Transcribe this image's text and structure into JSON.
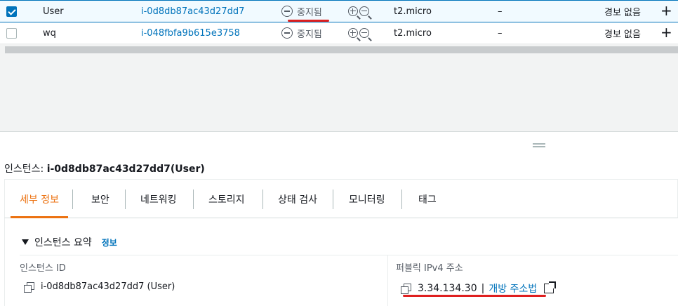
{
  "instances": [
    {
      "name": "User",
      "id": "i-0d8db87ac43d27dd7",
      "state": "중지됨",
      "type": "t2.micro",
      "status_check": "–",
      "alarm": "경보 없음",
      "checked": true
    },
    {
      "name": "wq",
      "id": "i-048fbfa9b615e3758",
      "state": "중지됨",
      "type": "t2.micro",
      "status_check": "–",
      "alarm": "경보 없음",
      "checked": false
    }
  ],
  "row_add_label": "+",
  "detail": {
    "title_prefix": "인스턴스: ",
    "title_value": "i-0d8db87ac43d27dd7(User)"
  },
  "tabs": [
    "세부 정보",
    "보안",
    "네트워킹",
    "스토리지",
    "상태 검사",
    "모니터링",
    "태그"
  ],
  "active_tab": "세부 정보",
  "summary": {
    "header": "인스턴스 요약",
    "info_link": "정보",
    "instance_id_label": "인스턴스 ID",
    "instance_id_value": "i-0d8db87ac43d27dd7 (User)",
    "public_ip_label": "퍼블릭 IPv4 주소",
    "public_ip_value": "3.34.134.30",
    "separator": "|",
    "open_address_link": "개방 주소법"
  },
  "colors": {
    "accent": "#0073bb",
    "active_tab": "#ec7211",
    "annotation_red": "#df1f1f"
  }
}
